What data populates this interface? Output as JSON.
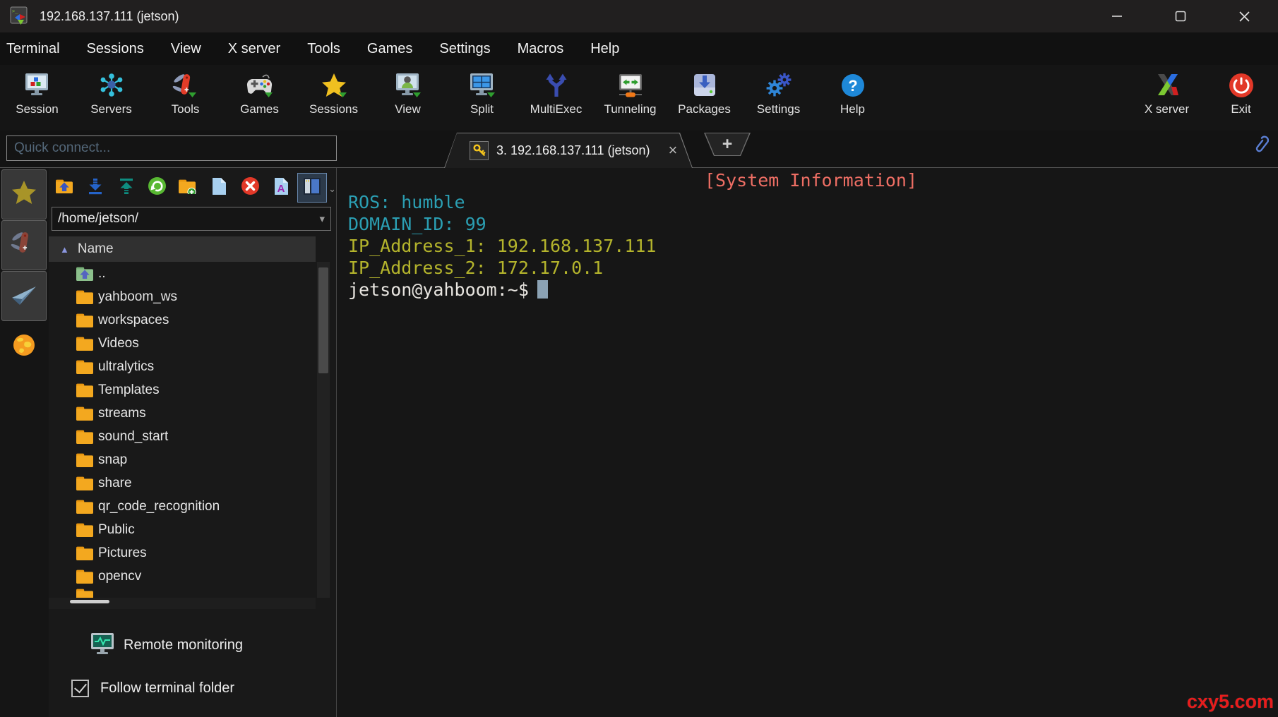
{
  "window": {
    "title": "192.168.137.111 (jetson)",
    "controls": [
      "minimize",
      "maximize",
      "close"
    ]
  },
  "menu": {
    "items": [
      "Terminal",
      "Sessions",
      "View",
      "X server",
      "Tools",
      "Games",
      "Settings",
      "Macros",
      "Help"
    ]
  },
  "toolbar": {
    "items": [
      {
        "label": "Session",
        "icon": "session-monitor-icon"
      },
      {
        "label": "Servers",
        "icon": "servers-network-icon"
      },
      {
        "label": "Tools",
        "icon": "tools-knife-icon"
      },
      {
        "label": "Games",
        "icon": "games-gamepad-icon"
      },
      {
        "label": "Sessions",
        "icon": "sessions-star-icon"
      },
      {
        "label": "View",
        "icon": "view-user-icon"
      },
      {
        "label": "Split",
        "icon": "split-screen-icon"
      },
      {
        "label": "MultiExec",
        "icon": "multiexec-fork-icon"
      },
      {
        "label": "Tunneling",
        "icon": "tunneling-monitor-icon"
      },
      {
        "label": "Packages",
        "icon": "packages-drive-icon"
      },
      {
        "label": "Settings",
        "icon": "settings-gears-icon"
      },
      {
        "label": "Help",
        "icon": "help-question-icon"
      }
    ],
    "right_items": [
      {
        "label": "X server",
        "icon": "xserver-x-icon"
      },
      {
        "label": "Exit",
        "icon": "exit-power-icon"
      }
    ]
  },
  "quick_connect": {
    "placeholder": "Quick connect..."
  },
  "tab_bar": {
    "active_tab": {
      "title": "3. 192.168.137.111 (jetson)",
      "close_glyph": "×",
      "key_icon": "key-icon"
    },
    "new_tab_glyph": "+",
    "attachments_icon": "paperclip-icon"
  },
  "rail": {
    "items": [
      {
        "icon": "sessions-star-icon-muted",
        "name": "sessions"
      },
      {
        "icon": "tools-knife-icon-muted",
        "name": "tools"
      },
      {
        "icon": "macros-paperplane-icon",
        "name": "macros"
      },
      {
        "icon": "sftp-globe-icon",
        "name": "sftp",
        "active": true
      }
    ]
  },
  "file_panel": {
    "toolbar_icons": [
      {
        "icon": "folder-up-icon"
      },
      {
        "icon": "download-icon"
      },
      {
        "icon": "upload-icon"
      },
      {
        "icon": "refresh-icon"
      },
      {
        "icon": "new-folder-icon"
      },
      {
        "icon": "new-file-icon"
      },
      {
        "icon": "delete-icon"
      },
      {
        "icon": "rename-icon"
      },
      {
        "icon": "dual-pane-icon",
        "selected": true
      }
    ],
    "path": "/home/jetson/",
    "header": {
      "label": "Name",
      "sort_glyph": "▲",
      "sort_color": "#8b97e0"
    },
    "files": [
      {
        "name": "..",
        "type": "parent"
      },
      {
        "name": "yahboom_ws",
        "type": "folder"
      },
      {
        "name": "workspaces",
        "type": "folder"
      },
      {
        "name": "Videos",
        "type": "folder"
      },
      {
        "name": "ultralytics",
        "type": "folder"
      },
      {
        "name": "Templates",
        "type": "folder"
      },
      {
        "name": "streams",
        "type": "folder"
      },
      {
        "name": "sound_start",
        "type": "folder"
      },
      {
        "name": "snap",
        "type": "folder"
      },
      {
        "name": "share",
        "type": "folder"
      },
      {
        "name": "qr_code_recognition",
        "type": "folder"
      },
      {
        "name": "Public",
        "type": "folder"
      },
      {
        "name": "Pictures",
        "type": "folder"
      },
      {
        "name": "opencv",
        "type": "folder"
      }
    ],
    "clipped_extra_row": true,
    "folder_color": "#f3a81f",
    "remote_monitoring_label": "Remote monitoring",
    "remote_monitoring_icon": "monitor-pulse-icon",
    "follow_terminal_folder": {
      "label": "Follow terminal folder",
      "checked": true
    }
  },
  "terminal": {
    "lines": [
      {
        "text": "[System Information]",
        "color": "#ee6e64",
        "align": "center"
      },
      {
        "text": "ROS: humble",
        "color": "#2b9fb3"
      },
      {
        "text": "DOMAIN_ID: 99",
        "color": "#2b9fb3"
      },
      {
        "text": "IP_Address_1: 192.168.137.111",
        "color": "#b4b42c"
      },
      {
        "text": "IP_Address_2: 172.17.0.1",
        "color": "#b4b42c"
      },
      {
        "text": "jetson@yahboom:~$",
        "color": "#e8e5e0",
        "cursor": true
      }
    ],
    "cursor_color": "#8ba2b4",
    "background": "#161616"
  },
  "watermark": {
    "text": "cxy5.com",
    "color": "#e81c1c"
  }
}
